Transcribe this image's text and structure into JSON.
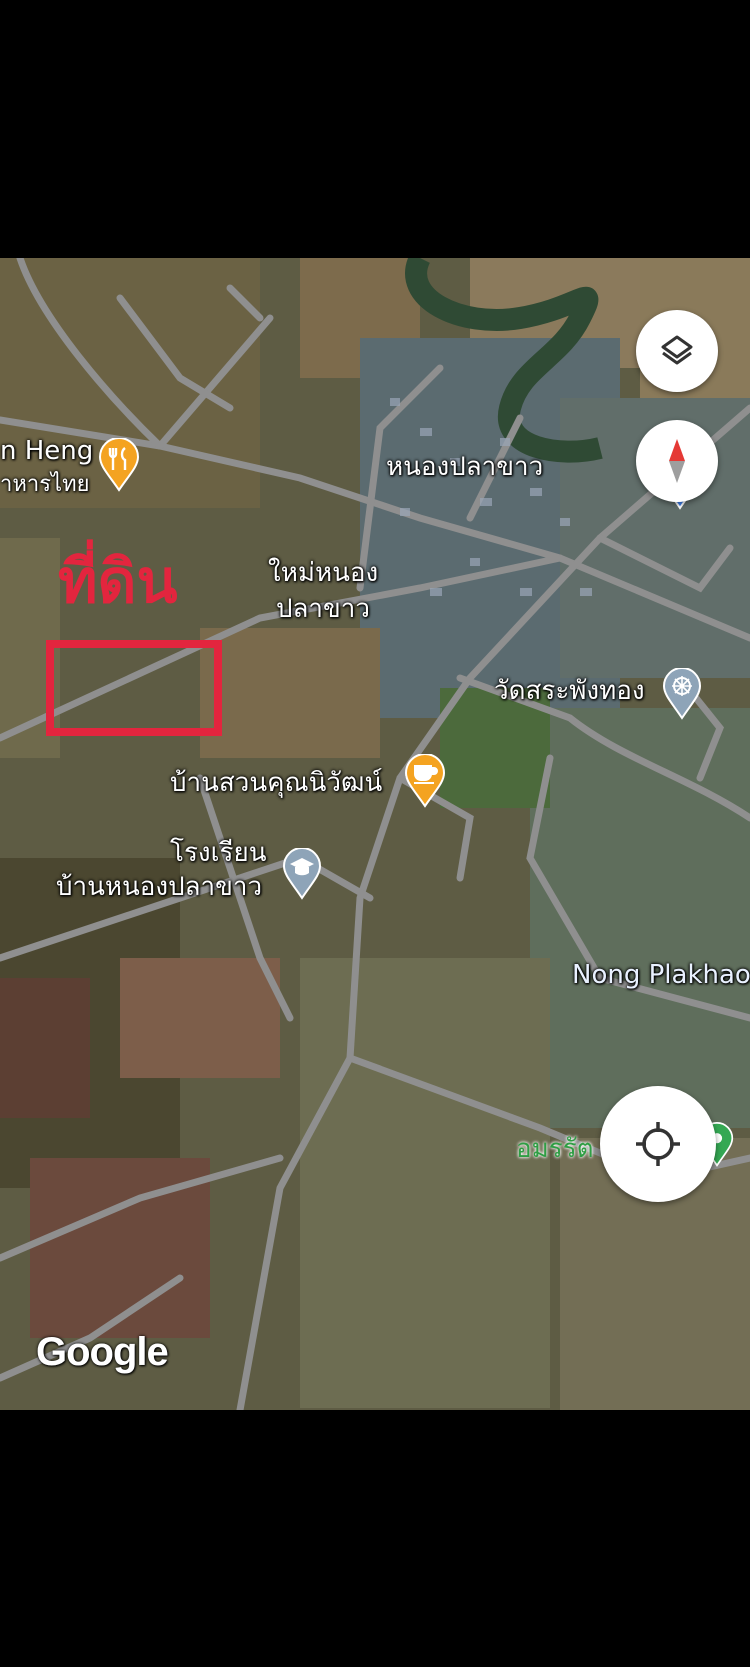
{
  "map": {
    "attribution": "Google",
    "annotation": {
      "label": "ที่ดิน",
      "color": "#e3253e"
    },
    "places": [
      {
        "name": "n Heng",
        "subtitle": "าหารไทย",
        "type": "restaurant"
      },
      {
        "name": "หนองปลาขาว",
        "type": "area"
      },
      {
        "name": "ใหม่หนอง",
        "name2": "ปลาขาว",
        "type": "area"
      },
      {
        "name": "วัดสระพังทอง",
        "type": "temple"
      },
      {
        "name": "บ้านสวนคุณนิวัฒน์",
        "type": "cafe"
      },
      {
        "name": "โรงเรียน",
        "name2": "บ้านหนองปลาขาว",
        "type": "school"
      },
      {
        "name": "Nong Plakhao",
        "type": "water"
      },
      {
        "name": "อมรรัต",
        "type": "park"
      }
    ],
    "controls": {
      "layers_icon": "layers-icon",
      "compass_icon": "compass-icon",
      "location_icon": "my-location-icon",
      "directions_icon": "directions-icon",
      "directions_color": "#1a73e8"
    },
    "pin_colors": {
      "food": "#f4a321",
      "temple": "#8ea4b8",
      "school": "#8ea4b8",
      "shop": "#4285f4",
      "park": "#34a853"
    }
  }
}
